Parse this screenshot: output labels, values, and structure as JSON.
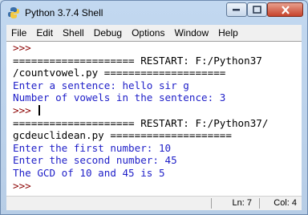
{
  "window": {
    "title": "Python 3.7.4 Shell"
  },
  "menu": [
    "File",
    "Edit",
    "Shell",
    "Debug",
    "Options",
    "Window",
    "Help"
  ],
  "shell_lines": [
    {
      "text": ">>> ",
      "kind": "prompt"
    },
    {
      "text": "==================== RESTART: F:/Python37",
      "kind": "blk"
    },
    {
      "text": "/countvowel.py ====================",
      "kind": "blk"
    },
    {
      "text": "Enter a sentence: hello sir g",
      "kind": "out"
    },
    {
      "text": "Number of vowels in the sentence: 3",
      "kind": "out"
    },
    {
      "text": ">>> ",
      "kind": "prompt",
      "caret": true
    },
    {
      "text": "==================== RESTART: F:/Python37/",
      "kind": "blk"
    },
    {
      "text": "gcdeuclidean.py ====================",
      "kind": "blk"
    },
    {
      "text": "Enter the first number: 10",
      "kind": "out"
    },
    {
      "text": "Enter the second number: 45",
      "kind": "out"
    },
    {
      "text": "The GCD of 10 and 45 is 5",
      "kind": "out"
    },
    {
      "text": ">>> ",
      "kind": "prompt"
    }
  ],
  "status": {
    "line": "Ln: 7",
    "col": "Col: 4"
  },
  "colors": {
    "prompt": "#8b0000",
    "output": "#1e1ec8",
    "text": "#000000"
  }
}
